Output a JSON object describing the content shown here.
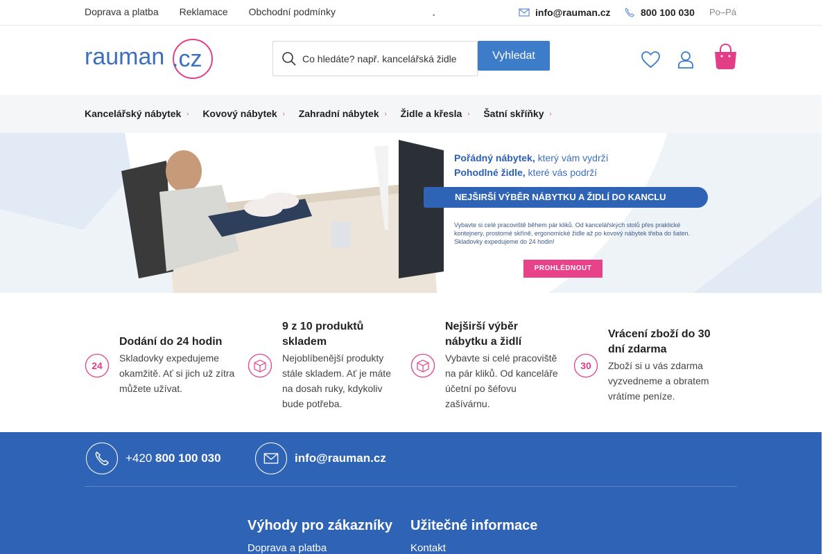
{
  "topbar": {
    "links": [
      "Doprava a platba",
      "Reklamace",
      "Obchodní podmínky"
    ],
    "email": "info@rauman.cz",
    "phone": "800 100 030",
    "hours": "Po–Pá"
  },
  "header": {
    "logo_text": "rauman.cz",
    "search_placeholder": "Co hledáte? např. kancelářská židle",
    "search_button": "Vyhledat"
  },
  "nav": {
    "items": [
      "Kancelářský nábytek",
      "Kovový nábytek",
      "Zahradní nábytek",
      "Židle a křesla",
      "Šatní skříňky"
    ]
  },
  "banner": {
    "line1_bold": "Pořádný nábytek,",
    "line1_rest": " který vám vydrží",
    "line2_bold": "Pohodlné židle,",
    "line2_rest": " které vás podrží",
    "pill": "NEJŠIRŠÍ VÝBĚR NÁBYTKU A ŽIDLÍ DO KANCLU",
    "small": "Vybavte si celé pracoviště během pár kliků. Od kancelářských stolů přes praktické kontejnery, prostorné skříně, ergonomické židle až po kovový nábytek třeba do šaten. Skladovky expedujeme do 24 hodin!",
    "cta": "PROHLÉDNOUT"
  },
  "features": [
    {
      "icon": "24-hours-icon",
      "title": "Dodání do 24 hodin",
      "desc": "Skladovky expedujeme okamžitě. Ať si jich už zítra můžete užívat."
    },
    {
      "icon": "box-icon",
      "title": "9 z 10 produktů skladem",
      "desc": "Nejoblíbenější produkty stále skladem. Ať je máte na dosah ruky, kdykoliv bude potřeba."
    },
    {
      "icon": "box-icon",
      "title": "Nejširší výběr nábytku a židlí",
      "desc": "Vybavte si celé pracoviště na pár kliků. Od kanceláře účetní po šéfovu zašívárnu."
    },
    {
      "icon": "30-days-icon",
      "title": "Vrácení zboží do 30 dní zdarma",
      "desc": "Zboží si u vás zdarma vyzvedneme a obratem vrátíme peníze."
    }
  ],
  "footer": {
    "phone_prefix": "+420 ",
    "phone": "800 100 030",
    "email": "info@rauman.cz",
    "col1_title": "Výhody pro zákazníky",
    "col1_link": "Doprava a platba",
    "col2_title": "Užitečné informace",
    "col2_link": "Kontakt"
  },
  "colors": {
    "brand_blue": "#2f63b6",
    "accent_pink": "#e23d87"
  }
}
